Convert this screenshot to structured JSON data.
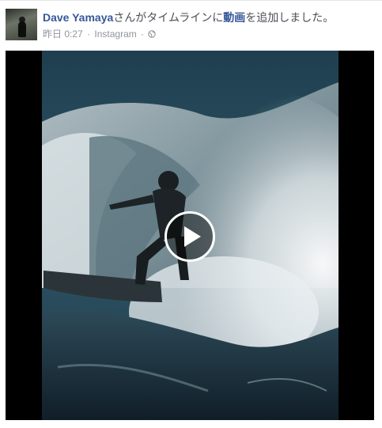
{
  "post": {
    "author_name": "Dave Yamaya",
    "action_text_before": "さんがタイムラインに",
    "action_link": "動画",
    "action_text_after": "を追加しました。",
    "timestamp": "昨日 0:27",
    "separator": "·",
    "source": "Instagram",
    "privacy_icon": "globe-icon"
  },
  "video": {
    "play_icon": "play-icon"
  }
}
